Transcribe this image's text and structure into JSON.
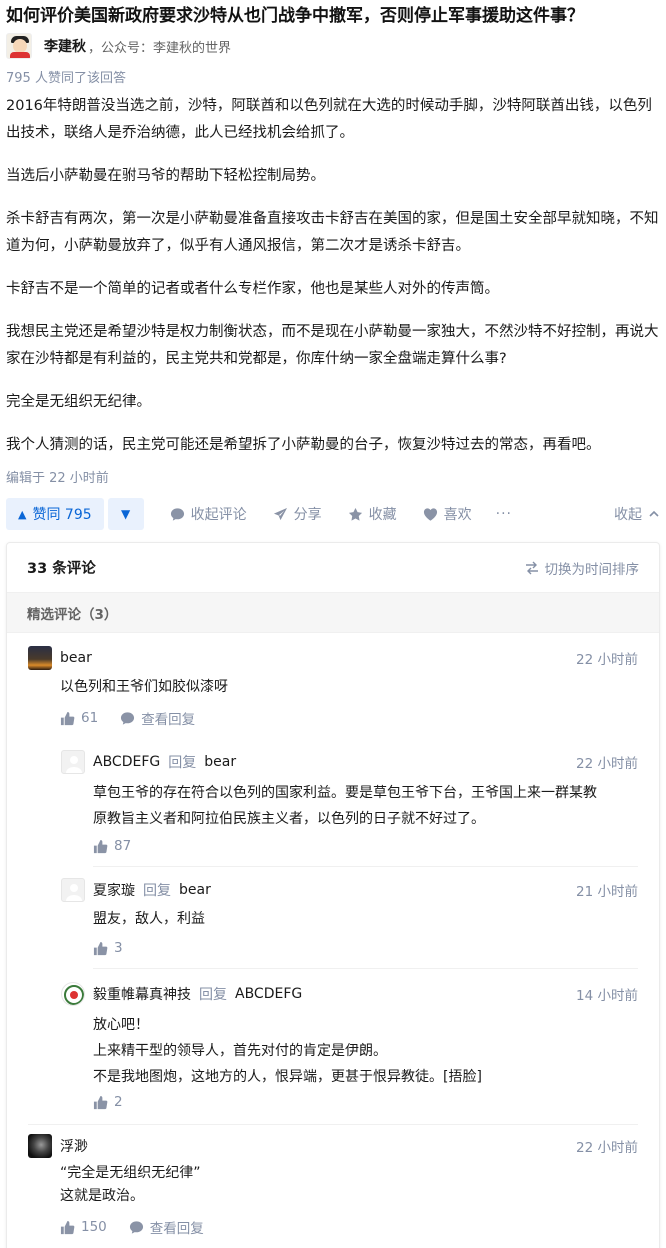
{
  "question": {
    "title": "如何评价美国新政府要求沙特从也门战争中撤军，否则停止军事援助这件事？"
  },
  "author": {
    "name": "李建秋",
    "desc": "，公众号：李建秋的世界"
  },
  "answer": {
    "vote_summary": "795 人赞同了该回答",
    "paragraphs": [
      "2016年特朗普没当选之前，沙特，阿联酋和以色列就在大选的时候动手脚，沙特阿联酋出钱，以色列出技术，联络人是乔治纳德，此人已经找机会给抓了。",
      "当选后小萨勒曼在驸马爷的帮助下轻松控制局势。",
      "杀卡舒吉有两次，第一次是小萨勒曼准备直接攻击卡舒吉在美国的家，但是国土安全部早就知晓，不知道为何，小萨勒曼放弃了，似乎有人通风报信，第二次才是诱杀卡舒吉。",
      "卡舒吉不是一个简单的记者或者什么专栏作家，他也是某些人对外的传声筒。",
      "我想民主党还是希望沙特是权力制衡状态，而不是现在小萨勒曼一家独大，不然沙特不好控制，再说大家在沙特都是有利益的，民主党共和党都是，你库什纳一家全盘端走算什么事?",
      "完全是无组织无纪律。",
      "我个人猜测的话，民主党可能还是希望拆了小萨勒曼的台子，恢复沙特过去的常态，再看吧。"
    ],
    "edit_time": "编辑于 22 小时前"
  },
  "actions": {
    "vote_up": "赞同 795",
    "comments_toggle": "收起评论",
    "share": "分享",
    "favorite": "收藏",
    "like": "喜欢",
    "more": "···",
    "collapse": "收起"
  },
  "comments": {
    "count_label": "33 条评论",
    "sort_label": "切换为时间排序",
    "featured_label": "精选评论（3）",
    "reply_word": "回复",
    "view_replies": "查看回复",
    "items": [
      {
        "user": "bear",
        "time": "22 小时前",
        "lines": [
          "以色列和王爷们如胶似漆呀"
        ],
        "likes": "61"
      },
      {
        "user": "ABCDEFG",
        "reply_to": "bear",
        "time": "22 小时前",
        "lines": [
          "草包王爷的存在符合以色列的国家利益。要是草包王爷下台，王爷国上来一群某教",
          "原教旨主义者和阿拉伯民族主义者，以色列的日子就不好过了。"
        ],
        "likes": "87"
      },
      {
        "user": "夏家璇",
        "reply_to": "bear",
        "time": "21 小时前",
        "lines": [
          "盟友，敌人，利益"
        ],
        "likes": "3"
      },
      {
        "user": "毅重帷幕真神技",
        "reply_to": "ABCDEFG",
        "time": "14 小时前",
        "lines": [
          "放心吧！",
          "上来精干型的领导人，首先对付的肯定是伊朗。",
          "不是我地图炮，这地方的人，恨异端，更甚于恨异教徒。[捂脸]"
        ],
        "likes": "2"
      },
      {
        "user": "浮渺",
        "time": "22 小时前",
        "lines": [
          "“完全是无组织无纪律”",
          "这就是政治。"
        ],
        "likes": "150"
      }
    ]
  }
}
